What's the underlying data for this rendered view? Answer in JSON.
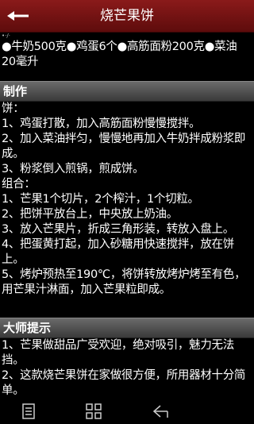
{
  "header": {
    "title": "烧芒果饼",
    "back_icon": "arrow-left-icon"
  },
  "content": {
    "cut_line": "•·/·",
    "ingredients": "●牛奶500克●鸡蛋6个●高筋面粉200克●菜油20毫升",
    "method": {
      "heading": "制作",
      "lines": [
        "饼：",
        "1、鸡蛋打散，加入高筋面粉慢慢搅拌。",
        "2、加入菜油拌匀，慢慢地再加入牛奶拌成粉浆即成。",
        "3、粉浆倒入煎锅，煎成饼。",
        "组合：",
        "1、芒果1个切片，2个榨汁，1个切粒。",
        "2、把饼平放台上，中央放上奶油。",
        "3、放入芒果片，折成三角形装，转放入盘上。",
        "4、把蛋黄打起，加入砂糖用快速搅拌，放在饼上。",
        "5、烤炉预热至190℃，将饼转放烤炉烤至有色，用芒果汁淋面，加入芒果粒即成。"
      ]
    },
    "tips": {
      "heading": "大师提示",
      "lines": [
        "1、芒果做甜品广受欢迎，绝对吸引，魅力无法挡。",
        "2、这款烧芒果饼在家做很方便，所用器材十分简单。"
      ]
    }
  },
  "bottom_nav": {
    "menu_icon": "menu-icon",
    "home_icon": "home-icon",
    "back_icon": "back-icon"
  }
}
